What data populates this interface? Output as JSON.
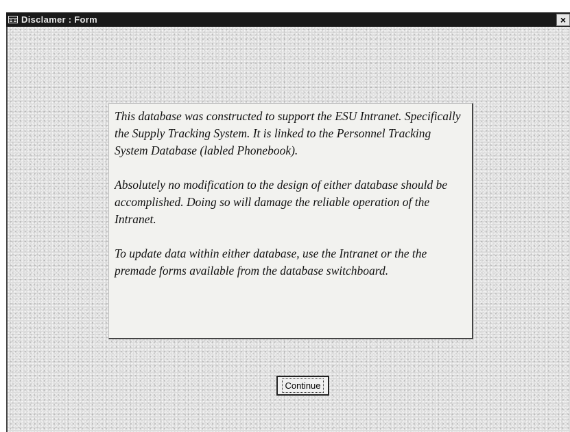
{
  "window": {
    "title": "Disclamer : Form",
    "close_glyph": "×"
  },
  "notice": {
    "paragraphs": [
      "This database was constructed to support the ESU Intranet. Specifically the Supply Tracking System. It is linked to the Personnel Tracking System Database (labled Phonebook).",
      "Absolutely no modification to the design of either database should be accomplished. Doing so will damage the reliable operation of the Intranet.",
      "To update data within either database, use the Intranet or the the premade forms available from the database switchboard."
    ]
  },
  "buttons": {
    "continue_label": "Continue"
  },
  "colors": {
    "titlebar": "#1a1a1a",
    "background": "#dcdcdc",
    "panel": "#f2f2ef"
  }
}
